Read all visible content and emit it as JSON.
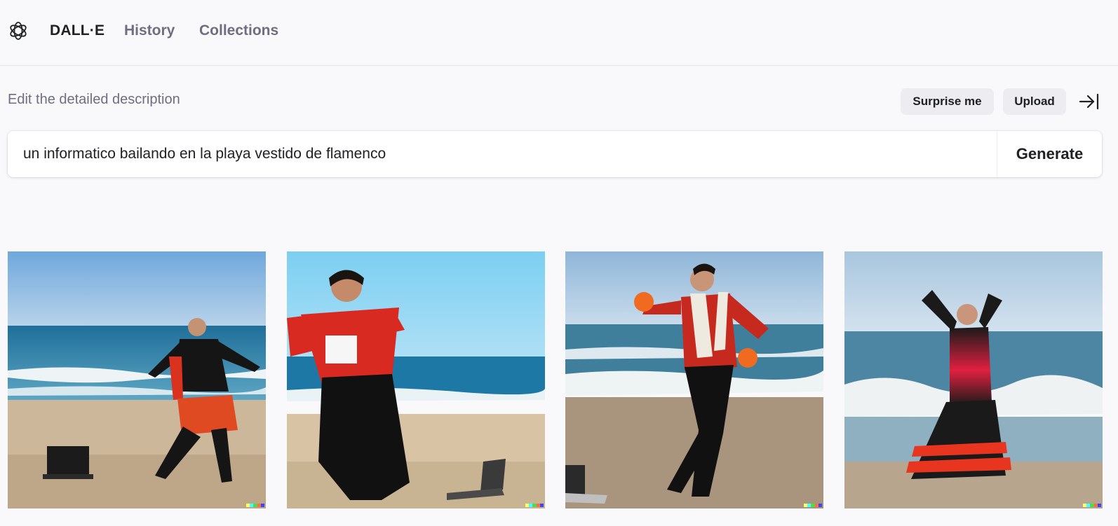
{
  "nav": {
    "brand": "DALL·E",
    "history": "History",
    "collections": "Collections"
  },
  "editor": {
    "label": "Edit the detailed description",
    "surprise_label": "Surprise me",
    "upload_label": "Upload",
    "prompt_value": "un informatico bailando en la playa vestido de flamenco",
    "generate_label": "Generate"
  },
  "icons": {
    "logo": "openai-logo-icon",
    "collapse": "arrow-right-to-bar-icon"
  },
  "colors": {
    "background": "#f9f9fb",
    "pill": "#ececf1",
    "text": "#202123",
    "muted": "#6e6e80"
  },
  "results": [
    {
      "name": "result-image-1",
      "scene": "man in black suit with red fringe dancing on beach with laptop"
    },
    {
      "name": "result-image-2",
      "scene": "man in red shirt and black trousers dancing beside laptop"
    },
    {
      "name": "result-image-3",
      "scene": "man in red shirt with white scarf dancing on sand"
    },
    {
      "name": "result-image-4",
      "scene": "woman in black and red flamenco dress dancing by waves"
    }
  ]
}
